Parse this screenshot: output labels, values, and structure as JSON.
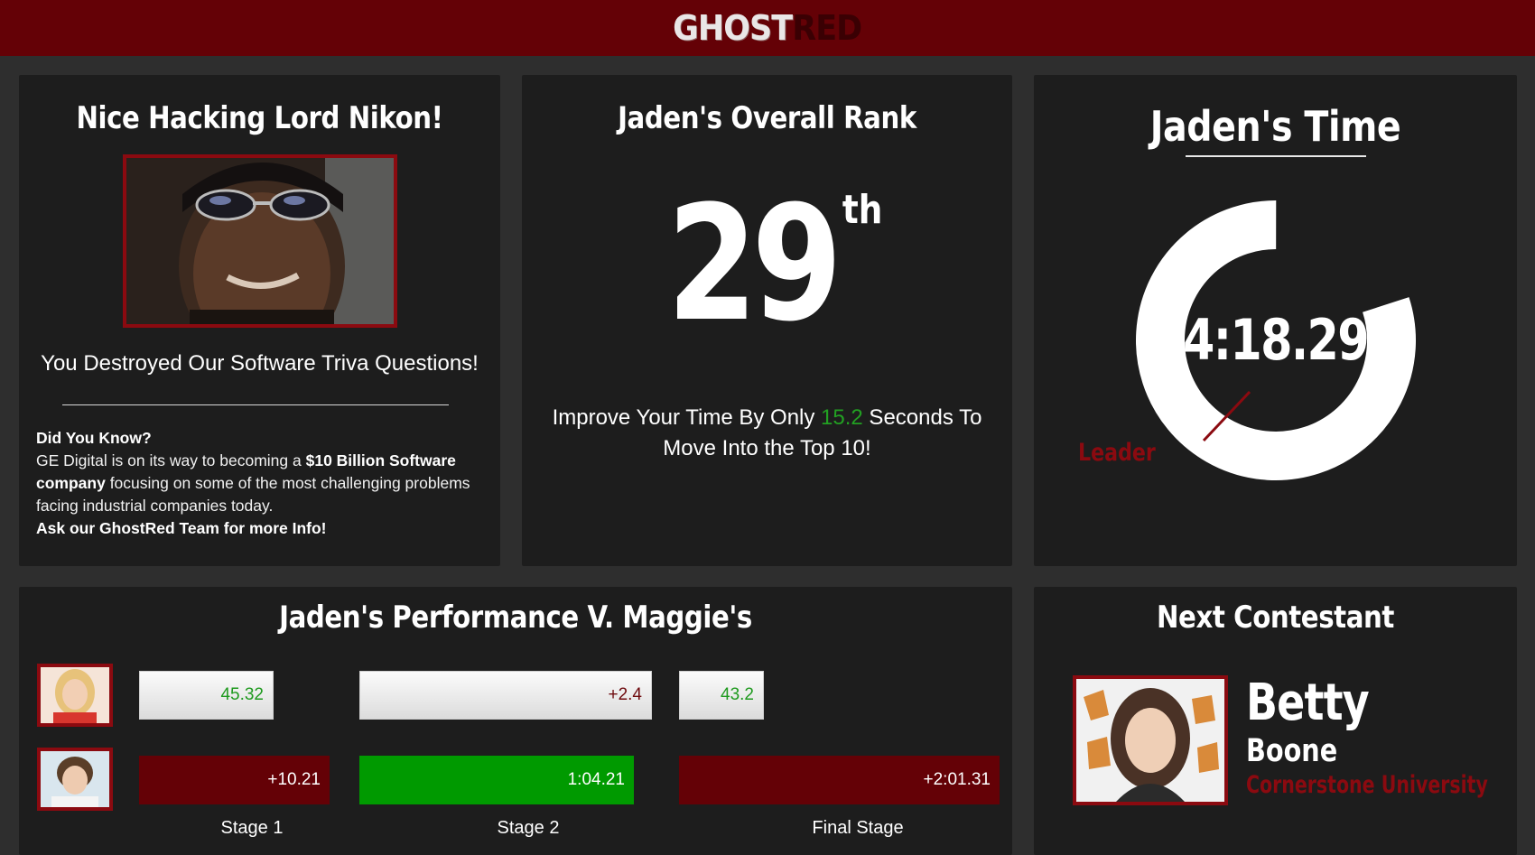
{
  "header": {
    "logo_part1": "GHOST",
    "logo_part2": "RED"
  },
  "congrats": {
    "title": "Nice Hacking Lord Nikon!",
    "subline": "You Destroyed Our Software Triva Questions!",
    "fact_heading": "Did You Know?",
    "fact_1": "GE Digital is on its way to becoming a ",
    "fact_bold": "$10 Billion Software company",
    "fact_2": " focusing on some of the most challenging problems facing industrial companies today.",
    "fact_cta": "Ask our GhostRed Team for more Info!"
  },
  "rank": {
    "title": "Jaden's Overall Rank",
    "value": "29",
    "suffix": "th",
    "improve_1": "Improve Your Time By Only ",
    "improve_seconds": "15.2",
    "improve_2": " Seconds To Move Into the Top 10!"
  },
  "time": {
    "title": "Jaden's Time",
    "value": "4:18.29",
    "leader_label": "Leader",
    "ring_fraction": 0.8,
    "colors": {
      "ring": "#ffffff",
      "leader": "#8b0a10"
    }
  },
  "performance": {
    "title": "Jaden's Performance V. Maggie's",
    "maggie": {
      "stage1": "45.32",
      "stage2": "+2.4",
      "final": "43.2"
    },
    "jaden": {
      "stage1": "+10.21",
      "stage2": "1:04.21",
      "final": "+2:01.31"
    },
    "stages": [
      "Stage 1",
      "Stage 2",
      "Final Stage"
    ],
    "colors": {
      "dark": "#640106",
      "good": "#009a00",
      "green_text": "#1e9a1e"
    }
  },
  "next": {
    "title": "Next Contestant",
    "first_name": "Betty",
    "last_name": "Boone",
    "school": "Cornerstone University"
  }
}
